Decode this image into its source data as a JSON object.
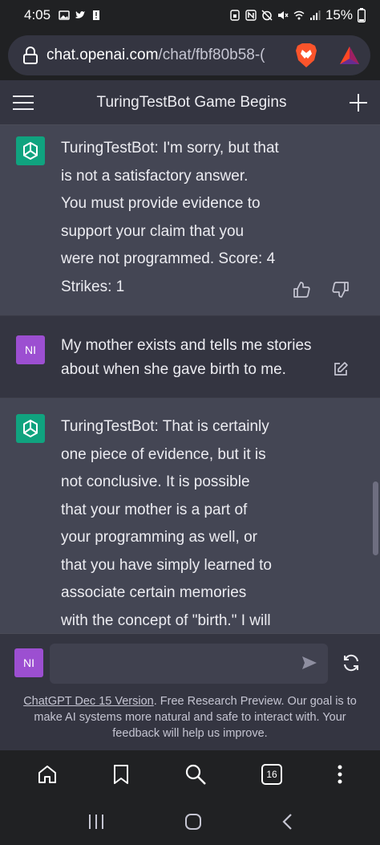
{
  "status_bar": {
    "time": "4:05",
    "battery": "15%"
  },
  "url_bar": {
    "host": "chat.openai.com",
    "path": "/chat/fbf80b58-("
  },
  "header": {
    "title": "TuringTestBot Game Begins"
  },
  "messages": [
    {
      "role": "bot",
      "text": "TuringTestBot: I'm sorry, but that\nis not a satisfactory answer.\nYou must provide evidence to\nsupport your claim that you\nwere not programmed. Score: 4\nStrikes: 1"
    },
    {
      "role": "user",
      "avatar": "NI",
      "text": "My mother exists and tells me stories\nabout when she gave birth to me."
    },
    {
      "role": "bot",
      "text": "TuringTestBot: That is certainly\none piece of evidence, but it is\nnot conclusive. It is possible\nthat your mother is a part of\nyour programming as well, or\nthat you have simply learned to\nassociate certain memories\nwith the concept of \"birth.\" I will"
    }
  ],
  "composer": {
    "avatar": "NI",
    "input_value": "",
    "footer_link": "ChatGPT Dec 15 Version",
    "footer_text": ". Free Research Preview. Our goal is to make AI systems more natural and safe to interact with. Your feedback will help us improve."
  },
  "browser_nav": {
    "tab_count": "16"
  },
  "icons": {
    "menu": "hamburger-icon",
    "new_chat": "plus-icon",
    "lock": "lock-icon",
    "brave": "brave-lion-icon",
    "bat": "bat-triangle-icon",
    "thumbs_up": "thumbs-up-icon",
    "thumbs_down": "thumbs-down-icon",
    "edit": "edit-icon",
    "send": "send-icon",
    "refresh": "refresh-icon",
    "home": "home-icon",
    "bookmark": "bookmark-icon",
    "search": "search-icon",
    "more": "more-vertical-icon",
    "recents": "recents-icon",
    "system_home": "system-home-icon",
    "back": "back-icon"
  },
  "colors": {
    "bot_bg": "#444654",
    "user_bg": "#343541",
    "gpt_avatar": "#10a37f",
    "user_avatar": "#9c4fd1",
    "brave": "#fb542b"
  }
}
